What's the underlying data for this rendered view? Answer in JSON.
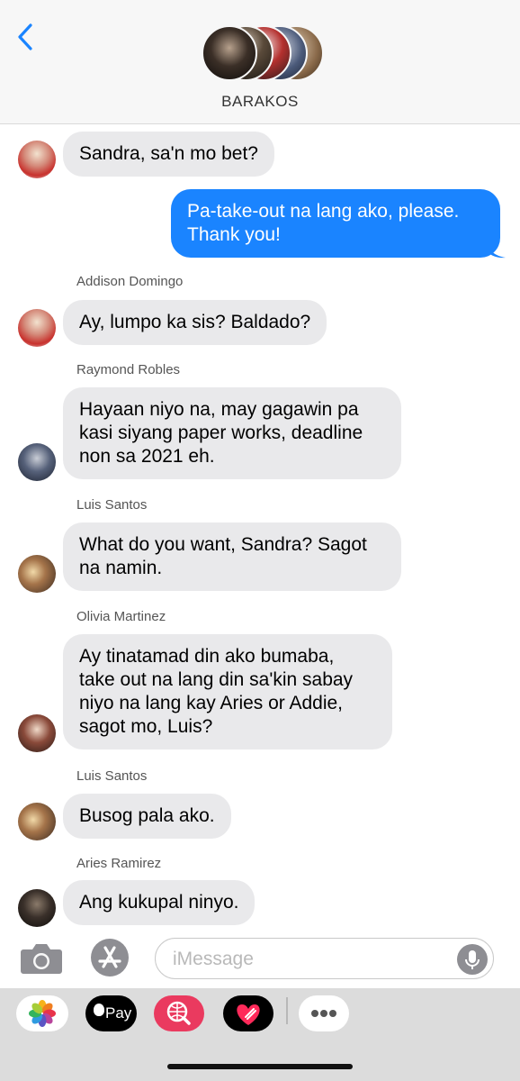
{
  "header": {
    "group_name": "BARAKOS"
  },
  "messages": [
    {
      "type": "incoming",
      "sender": "",
      "text_lines": [
        "Sandra, sa'n mo bet?"
      ],
      "avatar": "avatar-red-shirt"
    },
    {
      "type": "outgoing",
      "text_lines": [
        "Pa-take-out na lang ako, please.",
        "Thank you!"
      ]
    },
    {
      "type": "incoming",
      "sender": "Addison Domingo",
      "text_lines": [
        "Ay, lumpo ka sis? Baldado?"
      ],
      "avatar": "avatar-red-shirt"
    },
    {
      "type": "incoming",
      "sender": "Raymond Robles",
      "text_lines": [
        "Hayaan niyo na, may gagawin pa",
        "kasi siyang paper works, deadline",
        "non sa 2021 eh."
      ],
      "avatar": "avatar-sunglasses"
    },
    {
      "type": "incoming",
      "sender": "Luis Santos",
      "text_lines": [
        "What do you want, Sandra? Sagot",
        "na namin."
      ],
      "avatar": "avatar-sunset"
    },
    {
      "type": "incoming",
      "sender": "Olivia Martinez",
      "text_lines": [
        "Ay tinatamad din ako bumaba,",
        "take out na lang din sa'kin sabay",
        "niyo na lang kay Aries or Addie,",
        "sagot mo, Luis?"
      ],
      "avatar": "avatar-long-hair"
    },
    {
      "type": "incoming",
      "sender": "Luis Santos",
      "text_lines": [
        "Busog pala ako."
      ],
      "avatar": "avatar-sunset"
    },
    {
      "type": "incoming",
      "sender": "Aries Ramirez",
      "text_lines": [
        "Ang kukupal ninyo."
      ],
      "avatar": "avatar-dark"
    }
  ],
  "composer": {
    "placeholder": "iMessage"
  },
  "apps": {
    "apple_pay_label": "Pay",
    "apple_pay_logo": "apple-logo"
  },
  "colors": {
    "outgoing_bubble": "#1a84ff",
    "incoming_bubble": "#e9e9eb",
    "header_bg": "#f7f7f7",
    "drawer_bg": "#dcdcdc",
    "back_chevron": "#1a84ff"
  }
}
